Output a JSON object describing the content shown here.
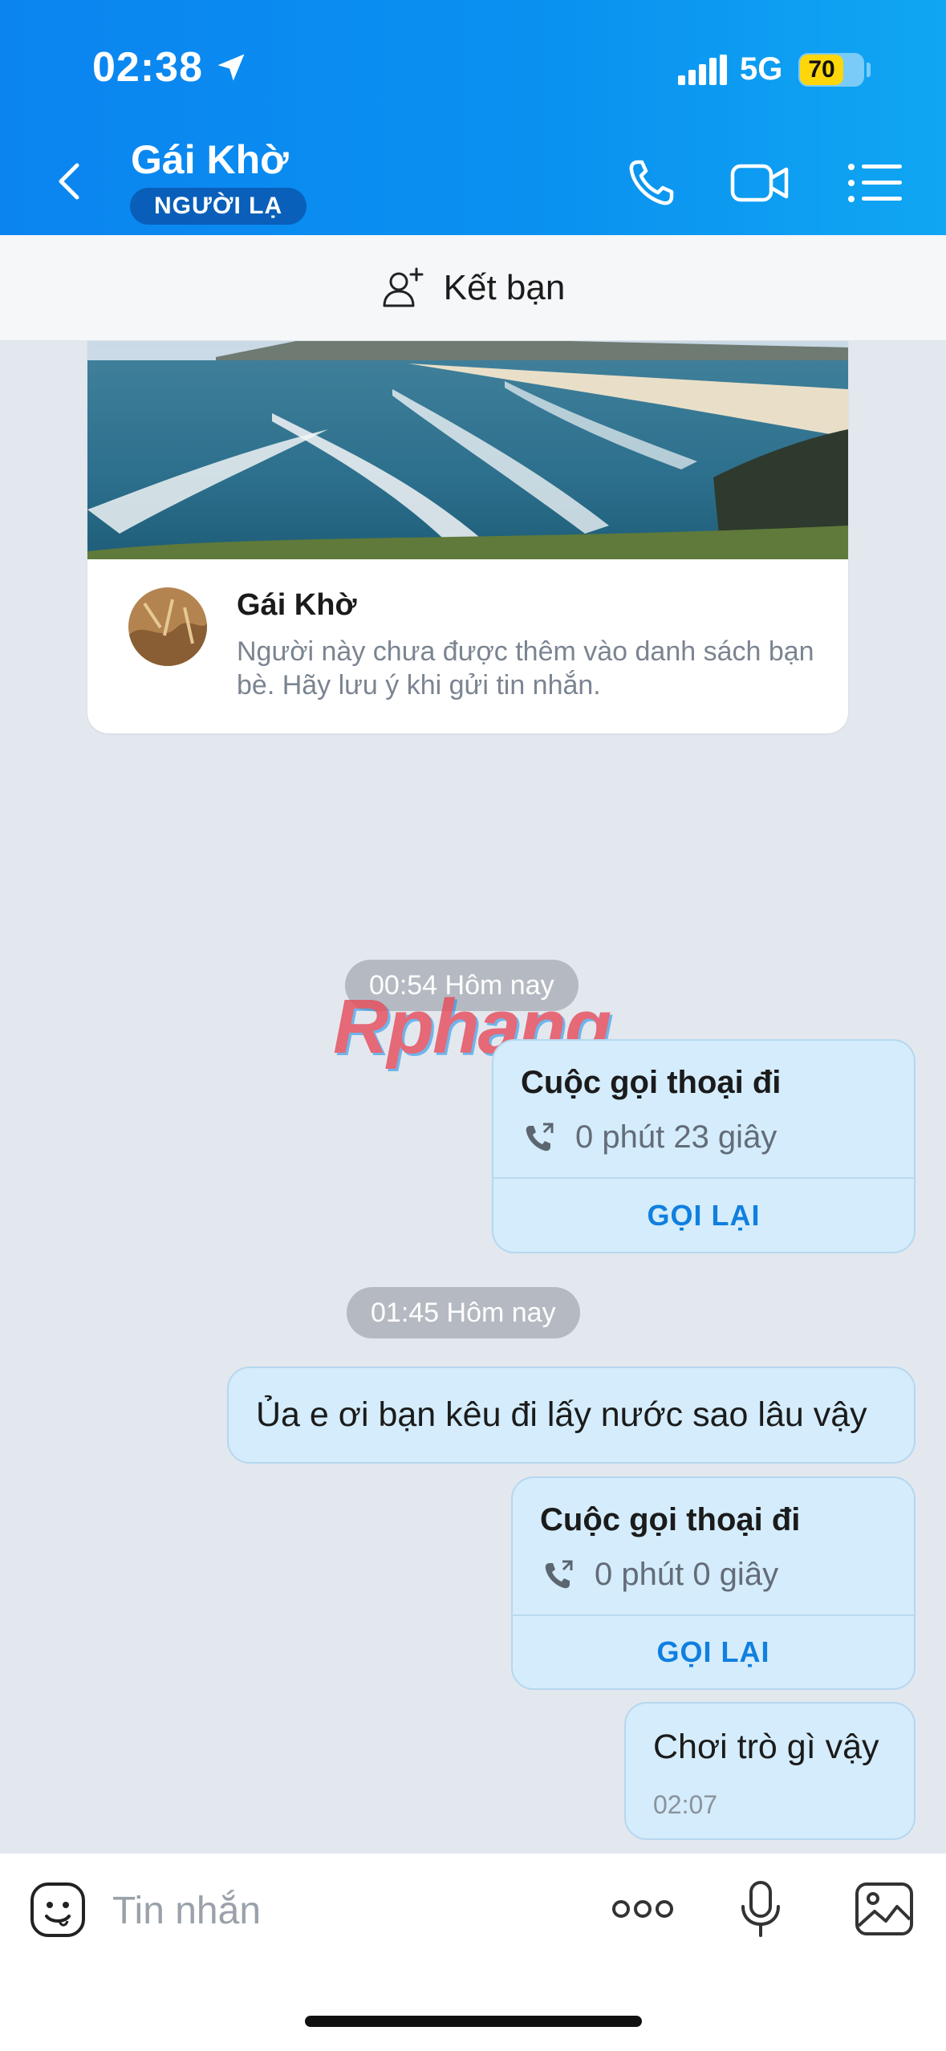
{
  "status_bar": {
    "time": "02:38",
    "network": "5G",
    "battery": "70",
    "location_icon": "location-arrow-icon",
    "signal_icon": "signal-bars-icon"
  },
  "header": {
    "contact_name": "Gái Khờ",
    "badge": "NGƯỜI LẠ",
    "icons": [
      "back-chevron-icon",
      "phone-icon",
      "video-camera-icon",
      "menu-list-icon"
    ],
    "background_color": "#0b84f0"
  },
  "add_friend": {
    "label": "Kết bạn",
    "icon": "add-person-icon"
  },
  "profile_card": {
    "name": "Gái Khờ",
    "note": "Người này chưa được thêm vào danh sách bạn bè. Hãy lưu ý khi gửi tin nhắn."
  },
  "watermark": "Rphang",
  "messages": [
    {
      "type": "time",
      "text": "00:54 Hôm nay"
    },
    {
      "type": "call",
      "title": "Cuộc gọi thoại đi",
      "duration": "0 phút 23 giây",
      "action": "GỌI LẠI"
    },
    {
      "type": "time",
      "text": "01:45 Hôm nay"
    },
    {
      "type": "text",
      "text": "Ủa e ơi bạn kêu đi lấy nước sao lâu vậy"
    },
    {
      "type": "call",
      "title": "Cuộc gọi thoại đi",
      "duration": "0 phút 0 giây",
      "action": "GỌI LẠI"
    },
    {
      "type": "text",
      "text": "Chơi trò gì vậy",
      "time": "02:07"
    }
  ],
  "input_bar": {
    "placeholder": "Tin nhắn",
    "icons": [
      "sticker-icon",
      "more-icon",
      "microphone-icon",
      "image-icon"
    ]
  },
  "colors": {
    "bubble": "#d4ecfb",
    "callback": "#0f7fe0",
    "chat_bg": "#e3e8ef"
  }
}
